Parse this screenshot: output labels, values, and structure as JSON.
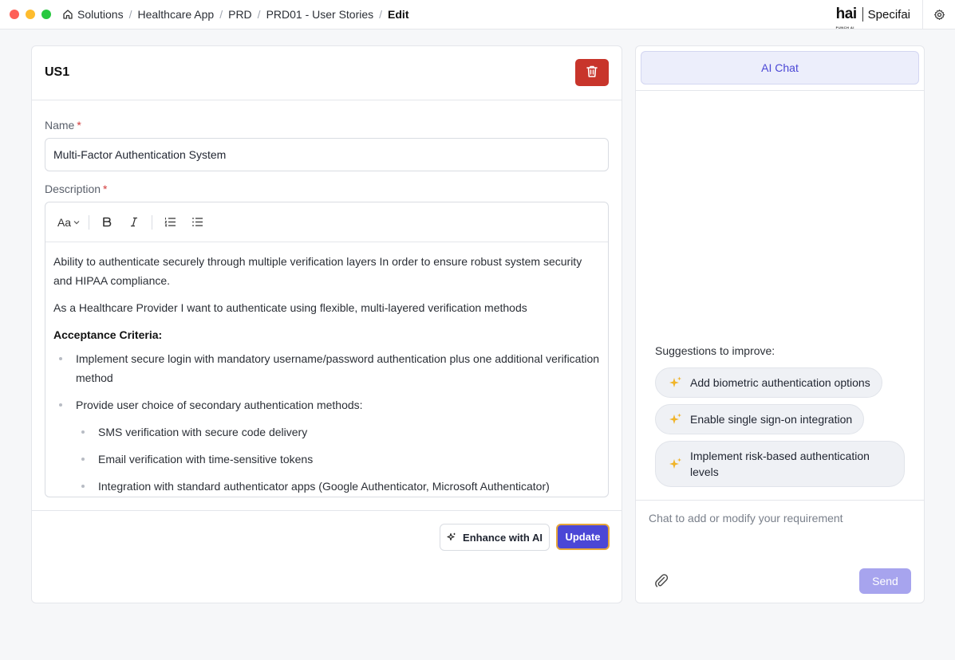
{
  "window": {
    "traffic_colors": [
      "#fe5f57",
      "#febc2e",
      "#28c840"
    ]
  },
  "breadcrumb": {
    "items": [
      "Solutions",
      "Healthcare App",
      "PRD",
      "PRD01 - User Stories"
    ],
    "current": "Edit",
    "separator": "/"
  },
  "brand": {
    "mark": "hai",
    "mark_sub": "PUNCH AI",
    "name": "Specifai"
  },
  "story": {
    "id": "US1",
    "name_label": "Name",
    "name_value": "Multi-Factor Authentication System",
    "description_label": "Description",
    "required_marker": "*",
    "toolbar": {
      "font_label": "Aa"
    },
    "description": {
      "para1": "Ability to authenticate securely through multiple verification layers In order to ensure robust system security and HIPAA compliance.",
      "para2": "As a Healthcare Provider I want to authenticate using flexible, multi-layered verification methods",
      "ac_title": "Acceptance Criteria:",
      "bullet1": "Implement secure login with mandatory username/password authentication plus one additional verification method",
      "bullet2": "Provide user choice of secondary authentication methods:",
      "sub1": "SMS verification with secure code delivery",
      "sub2": "Email verification with time-sensitive tokens",
      "sub3": "Integration with standard authenticator apps (Google Authenticator, Microsoft Authenticator)"
    },
    "enhance_label": "Enhance with AI",
    "update_label": "Update"
  },
  "chat": {
    "tab_label": "AI Chat",
    "suggestions_title": "Suggestions to improve:",
    "suggestions": [
      "Add biometric authentication options",
      "Enable single sign-on integration",
      "Implement risk-based authentication levels"
    ],
    "input_placeholder": "Chat to add or modify your requirement",
    "send_label": "Send"
  },
  "colors": {
    "accent": "#4b47d6",
    "danger": "#c8352b",
    "sparkle": "#f0b429"
  }
}
